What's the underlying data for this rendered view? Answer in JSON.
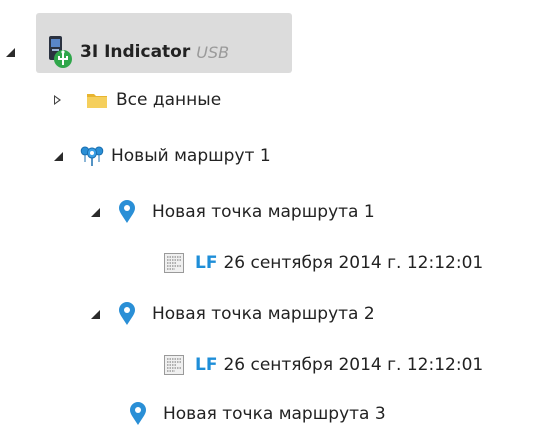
{
  "tree": {
    "device": {
      "name": "3I Indicator",
      "connection": "USB",
      "icon": "device-usb-icon"
    },
    "all_data": {
      "label": "Все данные",
      "icon": "folder-icon",
      "expanded": false
    },
    "route": {
      "label": "Новый маршрут 1",
      "icon": "route-icon",
      "expanded": true,
      "points": [
        {
          "label": "Новая точка маршрута 1",
          "expanded": true,
          "measurement": {
            "type": "LF",
            "timestamp": "26 сентября 2014 г. 12:12:01"
          }
        },
        {
          "label": "Новая точка маршрута 2",
          "expanded": true,
          "measurement": {
            "type": "LF",
            "timestamp": "26 сентября 2014 г. 12:12:01"
          }
        },
        {
          "label": "Новая точка маршрута 3",
          "expanded": false
        }
      ]
    }
  },
  "colors": {
    "selection": "#dcdcdc",
    "pin": "#2a8fd6",
    "lf": "#1e8ed8",
    "tag": "#9a9a9a"
  }
}
